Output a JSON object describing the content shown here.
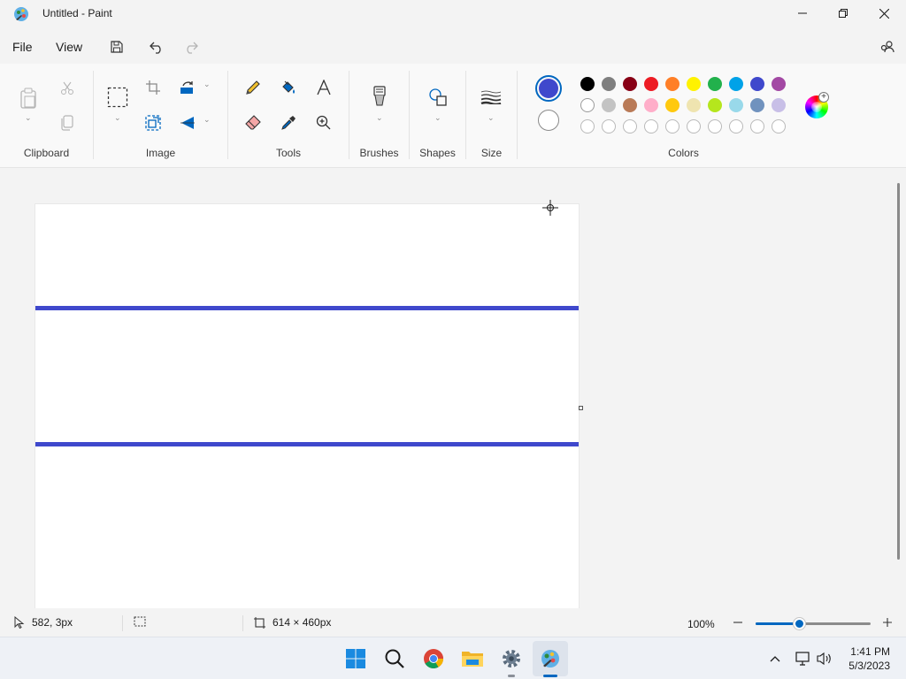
{
  "app": {
    "title": "Untitled - Paint"
  },
  "menu": {
    "file": "File",
    "view": "View"
  },
  "ribbon": {
    "groups": {
      "clipboard": "Clipboard",
      "image": "Image",
      "tools": "Tools",
      "brushes": "Brushes",
      "shapes": "Shapes",
      "size": "Size",
      "colors": "Colors"
    },
    "primary_color": "#3f48cc",
    "secondary_color": "#ffffff",
    "palette_row1": [
      "#000000",
      "#7f7f7f",
      "#880015",
      "#ed1c24",
      "#ff7f27",
      "#fff200",
      "#22b14c",
      "#00a2e8",
      "#3f48cc",
      "#a349a4"
    ],
    "palette_row2": [
      "#ffffff",
      "#c3c3c3",
      "#b97a57",
      "#ffaec9",
      "#ffc90e",
      "#efe4b0",
      "#b5e61d",
      "#99d9ea",
      "#7092be",
      "#c8bfe7"
    ]
  },
  "canvas": {
    "stroke_color": "#3f48cc"
  },
  "status": {
    "cursor_position": "582, 3px",
    "canvas_size": "614 × 460px",
    "zoom_level": "100%",
    "zoom_slider_fraction": 0.38
  },
  "taskbar": {
    "time": "1:41 PM",
    "date": "5/3/2023",
    "apps": [
      "start-icon",
      "search-icon",
      "chrome-icon",
      "file-explorer-icon",
      "settings-icon",
      "paint-icon"
    ]
  }
}
